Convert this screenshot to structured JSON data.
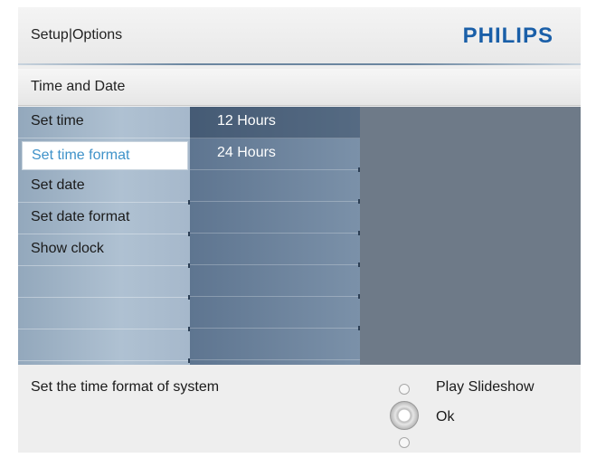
{
  "header": {
    "breadcrumb": "Setup|Options",
    "logo": "PHILIPS",
    "logo_color": "#1a5fa8"
  },
  "section": {
    "title": "Time and Date"
  },
  "menu": {
    "items": [
      {
        "label": "Set time"
      },
      {
        "label": "Set time format",
        "selected": true
      },
      {
        "label": "Set date"
      },
      {
        "label": "Set date format"
      },
      {
        "label": "Show clock"
      }
    ],
    "submenu": [
      {
        "label": "12 Hours",
        "highlighted": true
      },
      {
        "label": "24 Hours"
      }
    ]
  },
  "footer": {
    "hint": "Set the time format of system",
    "controls": [
      {
        "icon": "small-button-icon",
        "label": "Play Slideshow"
      },
      {
        "icon": "ok-button-icon",
        "label": "Ok"
      },
      {
        "icon": "small-button-icon",
        "label": ""
      }
    ]
  },
  "colors": {
    "selected_text": "#3f92c9",
    "menu_col1": "#a6b8cb",
    "menu_col2": "#6b82a0",
    "menu_col3": "#6e7a88"
  }
}
